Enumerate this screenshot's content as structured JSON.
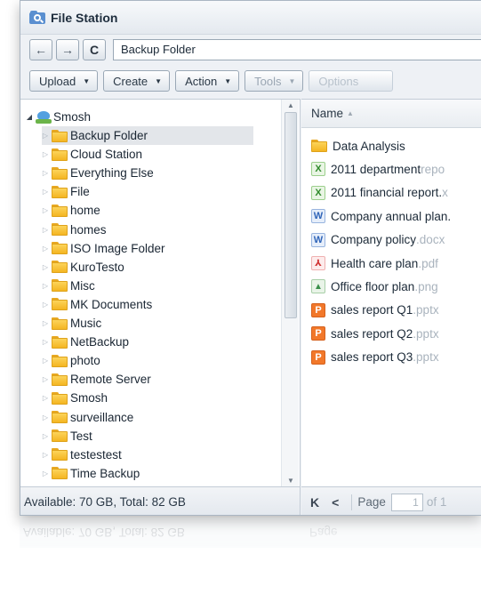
{
  "window": {
    "title": "File Station"
  },
  "nav": {
    "back_glyph": "←",
    "forward_glyph": "→",
    "refresh_glyph": "C",
    "path": "Backup Folder"
  },
  "toolbar": {
    "upload": "Upload",
    "create": "Create",
    "action": "Action",
    "tools": "Tools",
    "options": "Options"
  },
  "tree": {
    "root": "Smosh",
    "items": [
      "Backup Folder",
      "Cloud Station",
      "Everything Else",
      "File",
      "home",
      "homes",
      "ISO Image Folder",
      "KuroTesto",
      "Misc",
      "MK Documents",
      "Music",
      "NetBackup",
      "photo",
      "Remote Server",
      "Smosh",
      "surveillance",
      "Test",
      "testestest",
      "Time Backup"
    ],
    "selected_index": 0
  },
  "files": {
    "header": "Name",
    "items": [
      {
        "type": "folder",
        "name": "Data Analysis",
        "ext": ""
      },
      {
        "type": "xls",
        "name": "2011 department ",
        "ext": "repo"
      },
      {
        "type": "xls",
        "name": "2011 financial report.",
        "ext": "x"
      },
      {
        "type": "doc",
        "name": "Company annual plan.",
        "ext": ""
      },
      {
        "type": "doc",
        "name": "Company policy",
        "ext": ".docx"
      },
      {
        "type": "pdf",
        "name": "Health care plan",
        "ext": ".pdf"
      },
      {
        "type": "png",
        "name": "Office floor plan",
        "ext": ".png"
      },
      {
        "type": "ppt",
        "name": "sales report Q1",
        "ext": ".pptx"
      },
      {
        "type": "ppt",
        "name": "sales report Q2",
        "ext": ".pptx"
      },
      {
        "type": "ppt",
        "name": "sales report Q3",
        "ext": ".pptx"
      }
    ]
  },
  "status": {
    "storage": "Available: 70 GB, Total: 82 GB",
    "page_label": "Page",
    "page_value": "1",
    "page_of": "of 1"
  },
  "icons": {
    "xls": "X",
    "doc": "W",
    "pdf": "⅄",
    "png": "▲",
    "ppt": "P"
  }
}
